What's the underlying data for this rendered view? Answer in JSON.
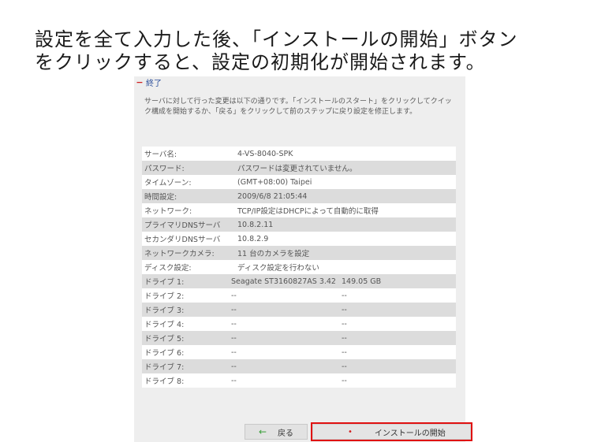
{
  "caption": {
    "line1": "設定を全て入力した後、「インストールの開始」ボタン",
    "line2": "をクリックすると、設定の初期化が開始されます。"
  },
  "section": {
    "toggle": "−",
    "title": "終了",
    "description": "サーバに対して行った変更は以下の通りです。「インストールのスタート」をクリックしてクイック構成を開始するか、「戻る」をクリックして前のステップに戻り設定を修正します。"
  },
  "summary": [
    {
      "label": "サーバ名:",
      "value": "4-VS-8040-SPK"
    },
    {
      "label": "パスワード:",
      "value": "パスワードは変更されていません。"
    },
    {
      "label": "タイムゾーン:",
      "value": "(GMT+08:00) Taipei"
    },
    {
      "label": "時間設定:",
      "value": "2009/6/8 21:05:44"
    },
    {
      "label": "ネットワーク:",
      "value": "TCP/IP設定はDHCPによって自動的に取得"
    },
    {
      "label": "プライマリDNSサーバ",
      "value": "10.8.2.11"
    },
    {
      "label": "セカンダリDNSサーバ",
      "value": "10.8.2.9"
    },
    {
      "label": "ネットワークカメラ:",
      "value": "11 台のカメラを設定"
    },
    {
      "label": "ディスク設定:",
      "value": "ディスク設定を行わない"
    }
  ],
  "drives": [
    {
      "label": "ドライブ 1:",
      "model": "Seagate ST3160827AS 3.42",
      "size": "149.05 GB"
    },
    {
      "label": "ドライブ 2:",
      "model": "--",
      "size": "--"
    },
    {
      "label": "ドライブ 3:",
      "model": "--",
      "size": "--"
    },
    {
      "label": "ドライブ 4:",
      "model": "--",
      "size": "--"
    },
    {
      "label": "ドライブ 5:",
      "model": "--",
      "size": "--"
    },
    {
      "label": "ドライブ 6:",
      "model": "--",
      "size": "--"
    },
    {
      "label": "ドライブ 7:",
      "model": "--",
      "size": "--"
    },
    {
      "label": "ドライブ 8:",
      "model": "--",
      "size": "--"
    }
  ],
  "buttons": {
    "back_icon": "←",
    "back_label": "戻る",
    "install_icon": "•",
    "install_label": "インストールの開始"
  },
  "colors": {
    "highlight_border": "#e01010",
    "panel_bg": "#eeeeee",
    "row_alt": "#dcdcdc"
  }
}
